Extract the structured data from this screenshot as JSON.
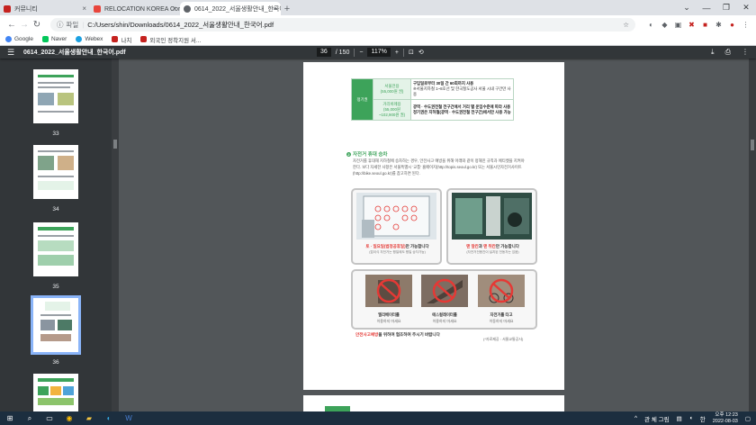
{
  "tabs": [
    {
      "label": "커뮤니티",
      "color": "#c5221f",
      "active": false
    },
    {
      "label": "RELOCATION KOREA Corp. 컨",
      "color": "#e8453c",
      "active": false
    },
    {
      "label": "0614_2022_서울생활안내_한국어",
      "color": "#5f6368",
      "active": true
    }
  ],
  "address": {
    "scheme_label": "파일",
    "url": "C:/Users/shin/Downloads/0614_2022_서울생활안내_한국어.pdf"
  },
  "bookmarks": [
    {
      "label": "Google",
      "color": "#4285f4"
    },
    {
      "label": "Naver",
      "color": "#03c75a"
    },
    {
      "label": "Webex",
      "color": "#1ba0e1"
    },
    {
      "label": "나치",
      "color": "#c5221f"
    },
    {
      "label": "외국인 정착지원 서...",
      "color": "#c5221f"
    }
  ],
  "pdf": {
    "filename": "0614_2022_서울생활안내_한국어.pdf",
    "page_current": "36",
    "page_total": "/ 150",
    "zoom": "117%",
    "minus": "−",
    "plus": "+"
  },
  "thumbnails": [
    {
      "num": "33"
    },
    {
      "num": "34"
    },
    {
      "num": "35"
    },
    {
      "num": "36"
    },
    {
      "num": "37"
    }
  ],
  "doc": {
    "category": "정기권",
    "row1_sub": "서울전용\n(55,000원 권)",
    "row1_desc1": "구입일로부터 30일 간 60회까지 사용",
    "row1_desc2": "※서울지하철 1~8호선 및 한국철도공사 서울 시내 구간만 사용",
    "row2_sub": "거리비례용\n(55,000원\n~102,900원 권)",
    "row2_desc1": "광역 · 수도권전철 전구간에서 거리 별 운임수준에 따라 사용",
    "row2_desc2": "정기권은 지하철(광역 · 수도권전철 전구간)에서만 사용 가능",
    "section_num": "2",
    "section_title": "자전거 휴대 승차",
    "section_body": "자전거를 휴대해 지하철에 승차하는 경우, 안전사고 예방을 위해 아래와 같이 정해진 규칙과 에티켓을 지켜야 한다. 보다 자세한 사항은 서울특별시 '교통' 홈페이지(http://topis.seoul.go.kr) 또는 서울시민자전거사이트(http://bike.seoul.go.kr)를 참고하면 된다.",
    "photo1_caption_red": "토 · 일요일(법정공휴일)",
    "photo1_caption_rest": "만 가능합니다",
    "photo1_sub": "(접이식 자전거는 평일에도 평일 승차가능)",
    "photo2_caption_red1": "맨 앞칸",
    "photo2_caption_mid": "과 ",
    "photo2_caption_red2": "맨 뒤칸",
    "photo2_caption_rest": "만 가능합니다",
    "photo2_sub": "(자전거전용칸이 설치된 전동차는 있음)",
    "no_items": [
      {
        "title": "엘리베이터를",
        "sub": "이용하지 마세요"
      },
      {
        "title": "에스컬레이터를",
        "sub": "이용하지 마세요"
      },
      {
        "title": "자전거를 타고",
        "sub": "이동하지 마세요"
      }
    ],
    "notice_red": "안전사고예방",
    "notice_rest": "을 위하여 협조하여 주시기 바랍니다",
    "source": "(*자료제공 : 서울교통공사)"
  },
  "taskbar": {
    "ime": "한",
    "tray_text": "관 체 그림",
    "time": "오후 12:23",
    "date": "2022-08-03"
  }
}
